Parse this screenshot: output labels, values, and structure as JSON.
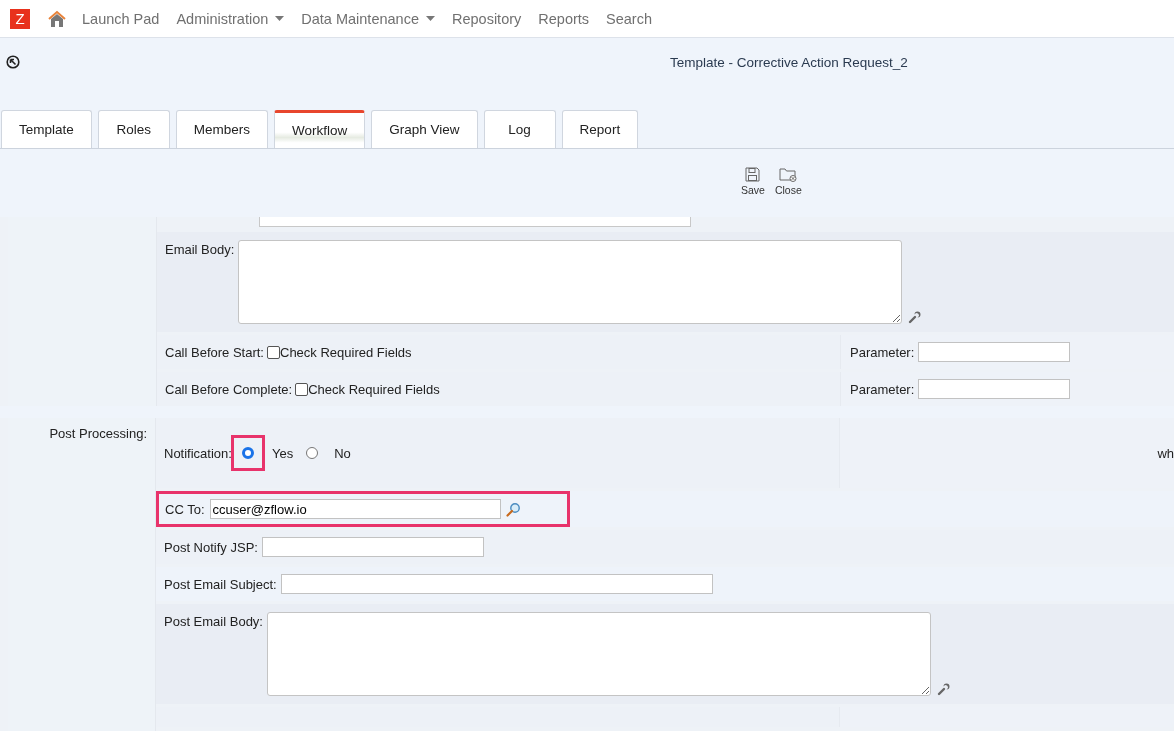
{
  "nav": {
    "logo": "Z",
    "items": [
      {
        "label": "Launch Pad",
        "dropdown": false
      },
      {
        "label": "Administration",
        "dropdown": true
      },
      {
        "label": "Data Maintenance",
        "dropdown": true
      },
      {
        "label": "Repository",
        "dropdown": false
      },
      {
        "label": "Reports",
        "dropdown": false
      },
      {
        "label": "Search",
        "dropdown": false
      }
    ]
  },
  "page_title": "Template - Corrective Action Request_2",
  "tabs": [
    {
      "label": "Template",
      "selected": false
    },
    {
      "label": "Roles",
      "selected": false
    },
    {
      "label": "Members",
      "selected": false
    },
    {
      "label": "Workflow",
      "selected": true
    },
    {
      "label": "Graph View",
      "selected": false
    },
    {
      "label": "Log",
      "selected": false
    },
    {
      "label": "Report",
      "selected": false
    }
  ],
  "toolbar": [
    {
      "label": "Save",
      "kind": "save"
    },
    {
      "label": "Close",
      "kind": "close"
    }
  ],
  "email_body": {
    "label": "Email Body:"
  },
  "call_rows": [
    {
      "label": "Call Before Start:",
      "checkbox_label": "Check Required Fields",
      "checked": false,
      "parameter_label": "Parameter:"
    },
    {
      "label": "Call Before Complete:",
      "checkbox_label": "Check Required Fields",
      "checked": false,
      "parameter_label": "Parameter:"
    }
  ],
  "post_processing": {
    "label": "Post Processing:",
    "notification": {
      "label": "Notification:",
      "options": [
        {
          "label": "Yes",
          "selected": true,
          "highlighted": true
        },
        {
          "label": "No",
          "selected": false,
          "highlighted": false
        }
      ]
    },
    "side_text": "wh",
    "cc_to": {
      "label": "CC To:",
      "value": "ccuser@zflow.io",
      "highlighted": true
    },
    "post_notify_jsp": {
      "label": "Post Notify JSP:"
    },
    "post_email_subject": {
      "label": "Post Email Subject:"
    },
    "post_email_body": {
      "label": "Post Email Body:"
    }
  }
}
